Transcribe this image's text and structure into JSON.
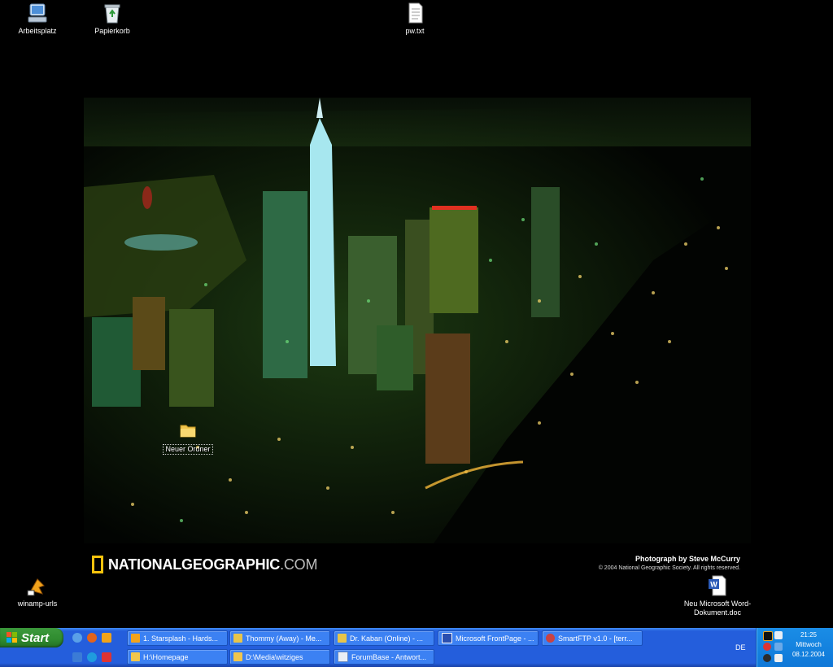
{
  "desktop": {
    "icons": [
      {
        "label": "Arbeitsplatz",
        "icon": "my-computer-icon"
      },
      {
        "label": "Papierkorb",
        "icon": "recycle-bin-icon"
      },
      {
        "label": "pw.txt",
        "icon": "text-file-icon"
      },
      {
        "label": "Neuer Ordner",
        "icon": "folder-icon"
      },
      {
        "label": "winamp-urls",
        "icon": "winamp-shortcut-icon"
      },
      {
        "label": "Neu Microsoft Word-Dokument.doc",
        "icon": "word-document-icon"
      }
    ]
  },
  "wallpaper": {
    "brand_bold": "NATIONALGEOGRAPHIC",
    "brand_suffix": ".COM",
    "credit_line1": "Photograph by Steve McCurry",
    "credit_line2": "© 2004 National Geographic Society. All rights reserved."
  },
  "taskbar": {
    "start_label": "Start",
    "buttons_row1": [
      {
        "label": "1. Starsplash - Hards...",
        "icon": "winamp-icon"
      },
      {
        "label": "Thommy (Away) - Me...",
        "icon": "messenger-icon"
      },
      {
        "label": "Dr. Kaban (Online) - ...",
        "icon": "messenger-icon"
      },
      {
        "label": "Microsoft FrontPage - ...",
        "icon": "frontpage-icon"
      },
      {
        "label": "SmartFTP v1.0 - [terr...",
        "icon": "ftp-icon"
      }
    ],
    "buttons_row2": [
      {
        "label": "H:\\Homepage",
        "icon": "folder-icon"
      },
      {
        "label": "D:\\Media\\witziges",
        "icon": "folder-icon"
      },
      {
        "label": "ForumBase - Antwort...",
        "icon": "browser-icon"
      }
    ],
    "language": "DE",
    "clock": {
      "time": "21:25",
      "day": "Mittwoch",
      "date": "08.12.2004"
    }
  },
  "colors": {
    "taskbar": "#245edc",
    "start": "#2f8b2f",
    "tray": "#0f78d8",
    "ng_yellow": "#f4c20d"
  }
}
